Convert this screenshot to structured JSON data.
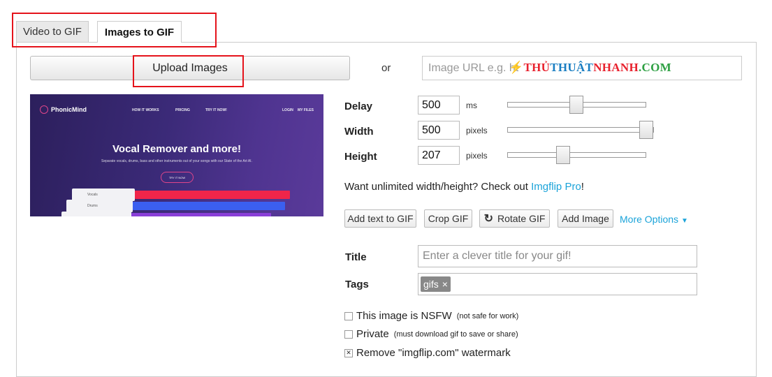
{
  "tabs": [
    {
      "label": "Video to GIF",
      "active": false
    },
    {
      "label": "Images to GIF",
      "active": true
    }
  ],
  "upload": {
    "label": "Upload Images"
  },
  "or_label": "or",
  "url_input": {
    "placeholder": "Image URL e.g. ht"
  },
  "watermark_overlay": {
    "part1": "THỦ",
    "part2": "THUẬT",
    "part3": "NHANH",
    "part4": ".COM"
  },
  "preview": {
    "brand": "PhonicMind",
    "nav": [
      "HOW IT WORKS",
      "PRICING",
      "TRY IT NOW!",
      "LOGIN",
      "MY FILES"
    ],
    "headline": "Vocal Remover and more!",
    "subline": "Separate vocals, drums, bass and other instruments out of your songs with our State of the Art AI.",
    "cta": "TRY IT NOW",
    "track_labels": [
      "Vocals",
      "Drums"
    ]
  },
  "settings": {
    "delay": {
      "label": "Delay",
      "value": "500",
      "unit": "ms",
      "slider_fraction": 0.49
    },
    "width": {
      "label": "Width",
      "value": "500",
      "unit": "pixels",
      "slider_fraction": 1.0
    },
    "height": {
      "label": "Height",
      "value": "207",
      "unit": "pixels",
      "slider_fraction": 0.4
    }
  },
  "promo": {
    "text": "Want unlimited width/height? Check out ",
    "link": "Imgflip Pro",
    "suffix": "!"
  },
  "actions": {
    "add_text": "Add text to GIF",
    "crop": "Crop GIF",
    "rotate": "Rotate GIF",
    "add_image": "Add Image",
    "more_options": "More Options"
  },
  "title_field": {
    "label": "Title",
    "placeholder": "Enter a clever title for your gif!"
  },
  "tags_field": {
    "label": "Tags",
    "tags": [
      "gifs"
    ]
  },
  "checkboxes": [
    {
      "label": "This image is NSFW",
      "note": "(not safe for work)",
      "checked": false
    },
    {
      "label": "Private",
      "note": "(must download gif to save or share)",
      "checked": false
    },
    {
      "label": "Remove \"imgflip.com\" watermark",
      "note": "",
      "checked": true
    }
  ],
  "colors": {
    "highlight": "#e5131b",
    "link": "#1aa3d9",
    "preview_bg": "#3b2a78"
  }
}
